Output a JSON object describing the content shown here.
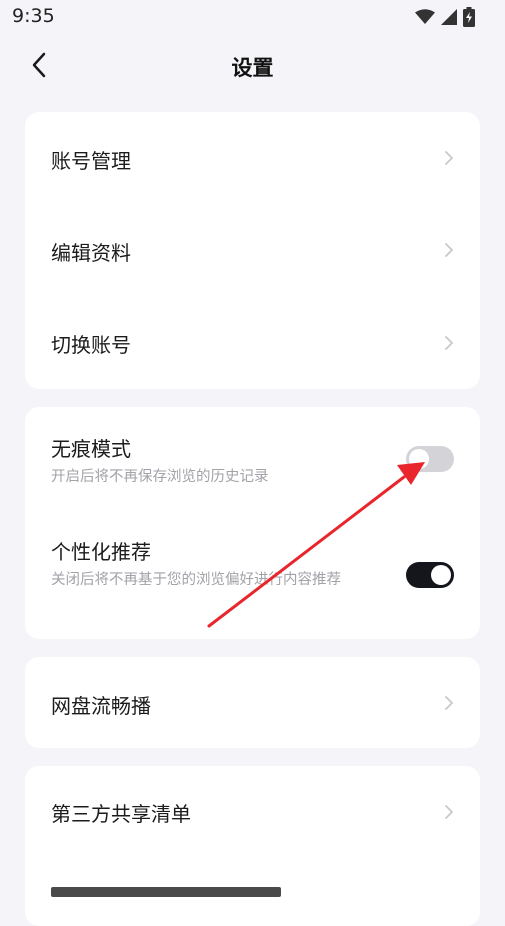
{
  "status_bar": {
    "time": "9:35",
    "icons": [
      "wifi-icon",
      "signal-icon",
      "battery-charging-icon"
    ]
  },
  "header": {
    "title": "设置",
    "back_icon": "chevron-left-icon"
  },
  "account_group": {
    "items": [
      {
        "label": "账号管理"
      },
      {
        "label": "编辑资料"
      },
      {
        "label": "切换账号"
      }
    ]
  },
  "privacy_group": {
    "incognito": {
      "label": "无痕模式",
      "description": "开启后将不再保存浏览的历史记录",
      "enabled": false
    },
    "personalized": {
      "label": "个性化推荐",
      "description": "关闭后将不再基于您的浏览偏好进行内容推荐",
      "enabled": true
    }
  },
  "cloud_group": {
    "items": [
      {
        "label": "网盘流畅播"
      }
    ]
  },
  "share_group": {
    "items": [
      {
        "label": "第三方共享清单"
      }
    ]
  },
  "colors": {
    "background": "#f5f5f9",
    "card": "#ffffff",
    "toggle_on": "#14161c",
    "toggle_off": "#d4d4d8",
    "annotation_arrow": "#e8262b"
  }
}
